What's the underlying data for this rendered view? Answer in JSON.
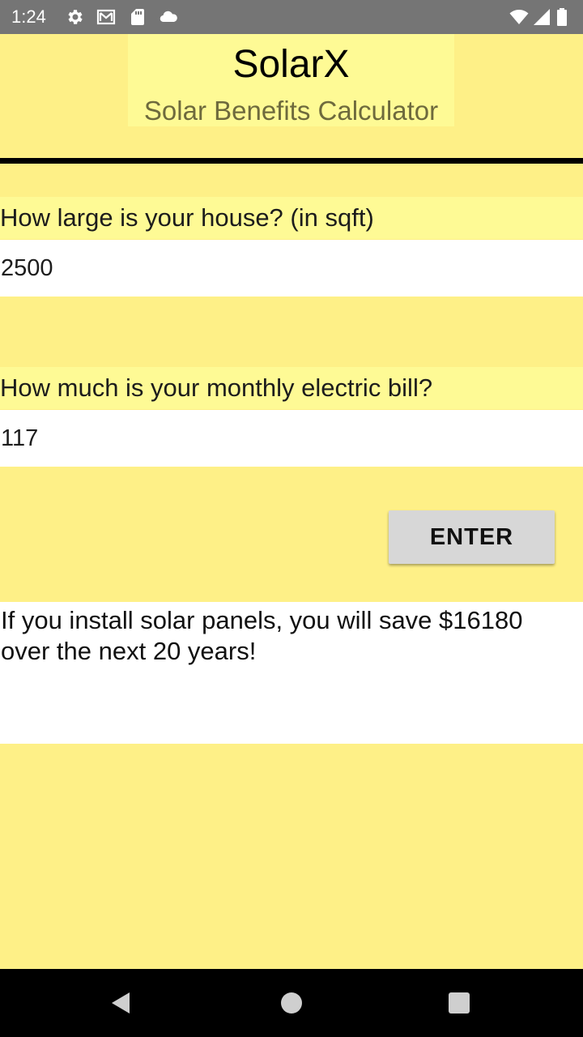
{
  "status_bar": {
    "time": "1:24",
    "icons": [
      "gear-icon",
      "gmail-icon",
      "sd-card-icon",
      "cloud-icon",
      "wifi-icon",
      "cell-signal-icon",
      "battery-icon"
    ]
  },
  "header": {
    "title": "SolarX",
    "subtitle": "Solar Benefits Calculator"
  },
  "form": {
    "house_size_label": "How large is your house? (in sqft)",
    "house_size_value": "2500",
    "electric_bill_label": "How much is your monthly electric bill?",
    "electric_bill_value": "117",
    "enter_label": "ENTER"
  },
  "result": {
    "text": "If you install solar panels, you will save $16180 over the next 20 years!"
  },
  "nav_bar": {
    "icons": [
      "back-icon",
      "home-icon",
      "recents-icon"
    ]
  },
  "colors": {
    "background": "#fef087",
    "label_background": "#fefa95",
    "status_bar": "#757575",
    "button": "#d7d7d7",
    "subtitle": "#6e6a3d"
  }
}
